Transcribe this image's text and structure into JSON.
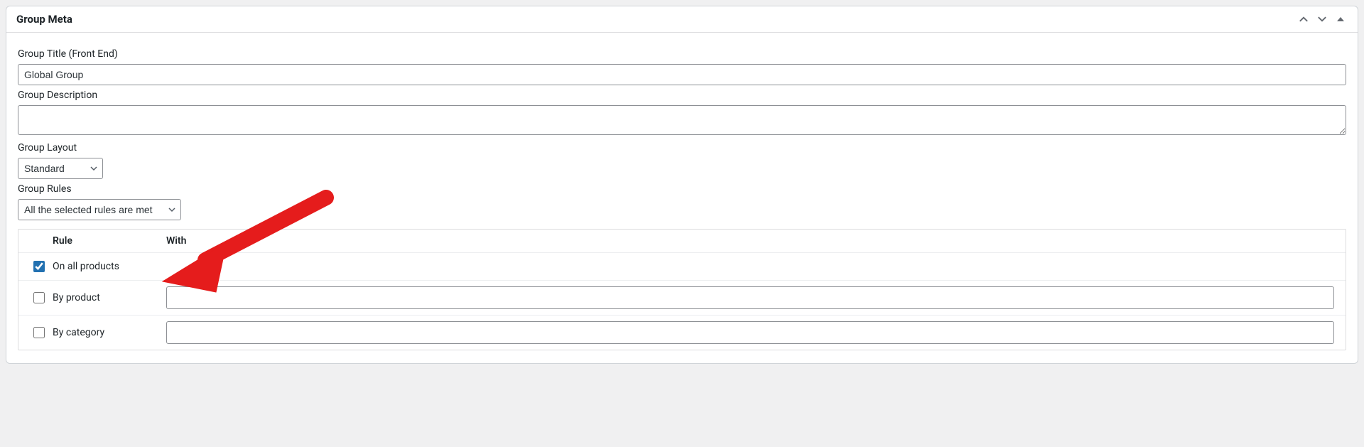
{
  "panel": {
    "title": "Group Meta"
  },
  "fields": {
    "group_title": {
      "label": "Group Title (Front End)",
      "value": "Global Group"
    },
    "group_description": {
      "label": "Group Description",
      "value": ""
    },
    "group_layout": {
      "label": "Group Layout",
      "selected": "Standard"
    },
    "group_rules": {
      "label": "Group Rules",
      "selected": "All the selected rules are met"
    }
  },
  "rules_table": {
    "headers": {
      "rule": "Rule",
      "with": "With"
    },
    "rows": [
      {
        "checked": true,
        "rule": "On all products",
        "with_input": false,
        "with_value": ""
      },
      {
        "checked": false,
        "rule": "By product",
        "with_input": true,
        "with_value": ""
      },
      {
        "checked": false,
        "rule": "By category",
        "with_input": true,
        "with_value": ""
      }
    ]
  },
  "colors": {
    "arrow": "#e51c1c"
  }
}
